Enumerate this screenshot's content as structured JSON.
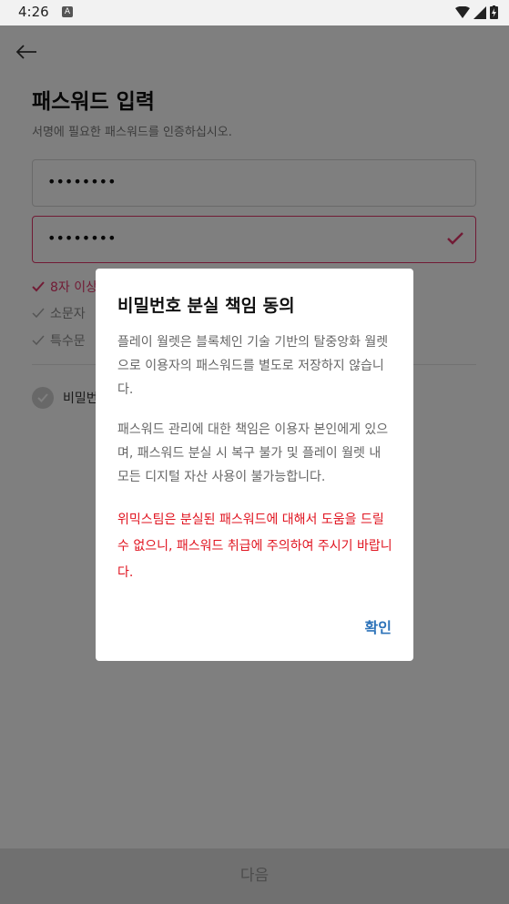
{
  "status": {
    "time": "4:26",
    "notif": "A"
  },
  "page": {
    "title": "패스워드 입력",
    "subtitle": "서명에 필요한 패스워드를 인증하십시오.",
    "password_mask": "••••••••",
    "confirm_mask": "••••••••",
    "rules": [
      "8자 이상",
      "소문자",
      "특수문"
    ],
    "agree_label": "비밀번",
    "next_button": "다음"
  },
  "dialog": {
    "title": "비밀번호 분실 책임 동의",
    "paragraph1": "플레이 월렛은 블록체인 기술 기반의 탈중앙화 월렛으로 이용자의 패스워드를 별도로 저장하지 않습니다.",
    "paragraph2": "패스워드 관리에 대한 책임은 이용자 본인에게 있으며, 패스워드 분실 시 복구 불가 및 플레이 월렛 내 모든 디지털 자산 사용이 불가능합니다.",
    "warning": "위믹스팀은 분실된 패스워드에 대해서 도움을 드릴 수 없으니, 패스워드 취급에 주의하여 주시기 바랍니다.",
    "confirm_button": "확인"
  },
  "colors": {
    "accent": "#e3376a",
    "warning": "#e0131f",
    "link": "#2d73b9"
  }
}
